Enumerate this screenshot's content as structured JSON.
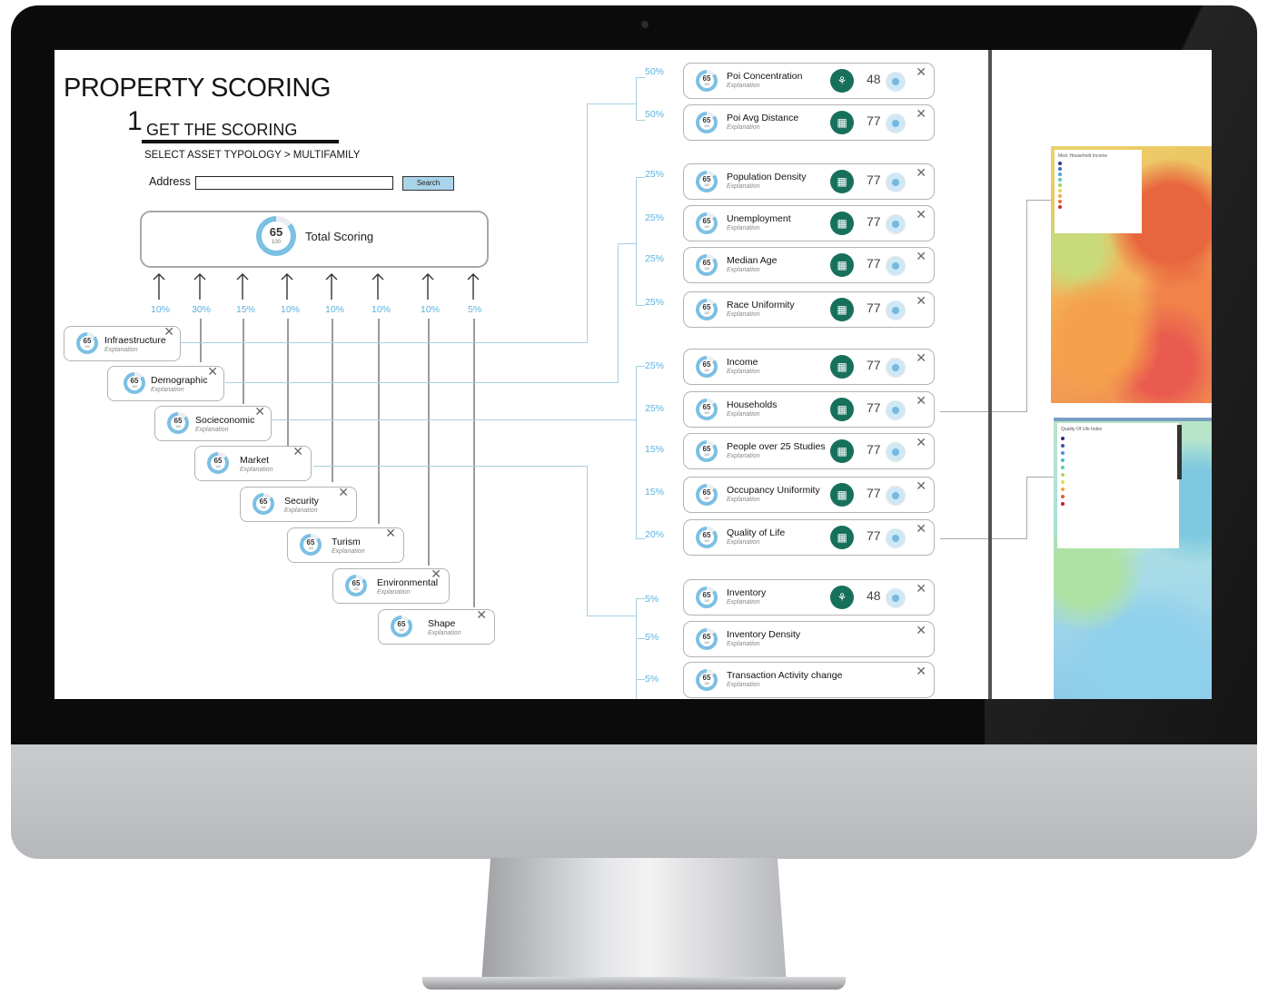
{
  "app": {
    "title": "PROPERTY SCORING",
    "step_number": "1",
    "step_title": "GET THE SCORING",
    "asset_typology": "SELECT ASSET TYPOLOGY > MULTIFAMILY",
    "address_label": "Address",
    "address_value": "",
    "search_label": "Search"
  },
  "total": {
    "score": "65",
    "max": "100",
    "label": "Total Scoring"
  },
  "weights": [
    "10%",
    "30%",
    "15%",
    "10%",
    "10%",
    "10%",
    "10%",
    "5%"
  ],
  "categories": [
    {
      "label": "Infraestructure",
      "explanation": "Explanation",
      "score": "65",
      "max": "100"
    },
    {
      "label": "Demographic",
      "explanation": "Explanation",
      "score": "65",
      "max": "100"
    },
    {
      "label": "Socieconomic",
      "explanation": "Explanation",
      "score": "65",
      "max": "100"
    },
    {
      "label": "Market",
      "explanation": "Explanation",
      "score": "65",
      "max": "100"
    },
    {
      "label": "Security",
      "explanation": "Explanation",
      "score": "65",
      "max": "100"
    },
    {
      "label": "Turism",
      "explanation": "Explanation",
      "score": "65",
      "max": "100"
    },
    {
      "label": "Environmental",
      "explanation": "Explanation",
      "score": "65",
      "max": "100"
    },
    {
      "label": "Shape",
      "explanation": "Explanation",
      "score": "65",
      "max": "100"
    }
  ],
  "metrics": [
    {
      "pct": "50%",
      "label": "Poi Concentration",
      "explanation": "Explanation",
      "score": "65",
      "max": "100",
      "badge_icon": "walk-icon",
      "value": "48"
    },
    {
      "pct": "50%",
      "label": "Poi Avg Distance",
      "explanation": "Explanation",
      "score": "65",
      "max": "100",
      "badge_icon": "building-icon",
      "value": "77"
    },
    {
      "pct": "25%",
      "label": "Population Density",
      "explanation": "Explanation",
      "score": "65",
      "max": "100",
      "badge_icon": "building-icon",
      "value": "77"
    },
    {
      "pct": "25%",
      "label": "Unemployment",
      "explanation": "Explanation",
      "score": "65",
      "max": "100",
      "badge_icon": "building-icon",
      "value": "77"
    },
    {
      "pct": "25%",
      "label": "Median Age",
      "explanation": "Explanation",
      "score": "65",
      "max": "100",
      "badge_icon": "building-icon",
      "value": "77"
    },
    {
      "pct": "25%",
      "label": "Race Uniformity",
      "explanation": "Explanation",
      "score": "65",
      "max": "100",
      "badge_icon": "building-icon",
      "value": "77"
    },
    {
      "pct": "25%",
      "label": "Income",
      "explanation": "Explanation",
      "score": "65",
      "max": "100",
      "badge_icon": "building-icon",
      "value": "77"
    },
    {
      "pct": "25%",
      "label": "Households",
      "explanation": "Explanation",
      "score": "65",
      "max": "100",
      "badge_icon": "building-icon",
      "value": "77"
    },
    {
      "pct": "15%",
      "label": "People over 25 Studies",
      "explanation": "Explanation",
      "score": "65",
      "max": "100",
      "badge_icon": "building-icon",
      "value": "77"
    },
    {
      "pct": "15%",
      "label": "Occupancy Uniformity",
      "explanation": "Explanation",
      "score": "65",
      "max": "100",
      "badge_icon": "building-icon",
      "value": "77"
    },
    {
      "pct": "20%",
      "label": "Quality of Life",
      "explanation": "Explanation",
      "score": "65",
      "max": "100",
      "badge_icon": "building-icon",
      "value": "77"
    },
    {
      "pct": "5%",
      "label": "Inventory",
      "explanation": "Explanation",
      "score": "65",
      "max": "100",
      "badge_icon": "walk-icon",
      "value": "48"
    },
    {
      "pct": "5%",
      "label": "Inventory Density",
      "explanation": "Explanation",
      "score": "65",
      "max": "100"
    },
    {
      "pct": "5%",
      "label": "Transaction Activity change",
      "explanation": "Explanation",
      "score": "65",
      "max": "100"
    }
  ],
  "maps": [
    {
      "legend_title": "Med. Household Income"
    },
    {
      "legend_title": "Quality Of Life Index"
    }
  ],
  "colors": {
    "accent": "#5cb2dd",
    "ring": "#7cc0e3",
    "badge": "#17705c"
  }
}
